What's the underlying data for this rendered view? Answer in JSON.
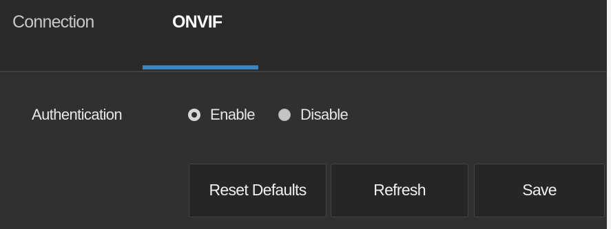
{
  "tabs": [
    {
      "label": "Connection",
      "active": false
    },
    {
      "label": "ONVIF",
      "active": true
    }
  ],
  "authentication": {
    "label": "Authentication",
    "options": [
      {
        "label": "Enable",
        "selected": true
      },
      {
        "label": "Disable",
        "selected": false
      }
    ]
  },
  "actions": {
    "reset_label": "Reset Defaults",
    "refresh_label": "Refresh",
    "save_label": "Save"
  },
  "colors": {
    "panel_background": "#303030",
    "tab_bar_background": "#2a2a2a",
    "active_tab_indicator": "#3b86c1",
    "button_background": "#262626",
    "text": "#e6e6e6"
  }
}
